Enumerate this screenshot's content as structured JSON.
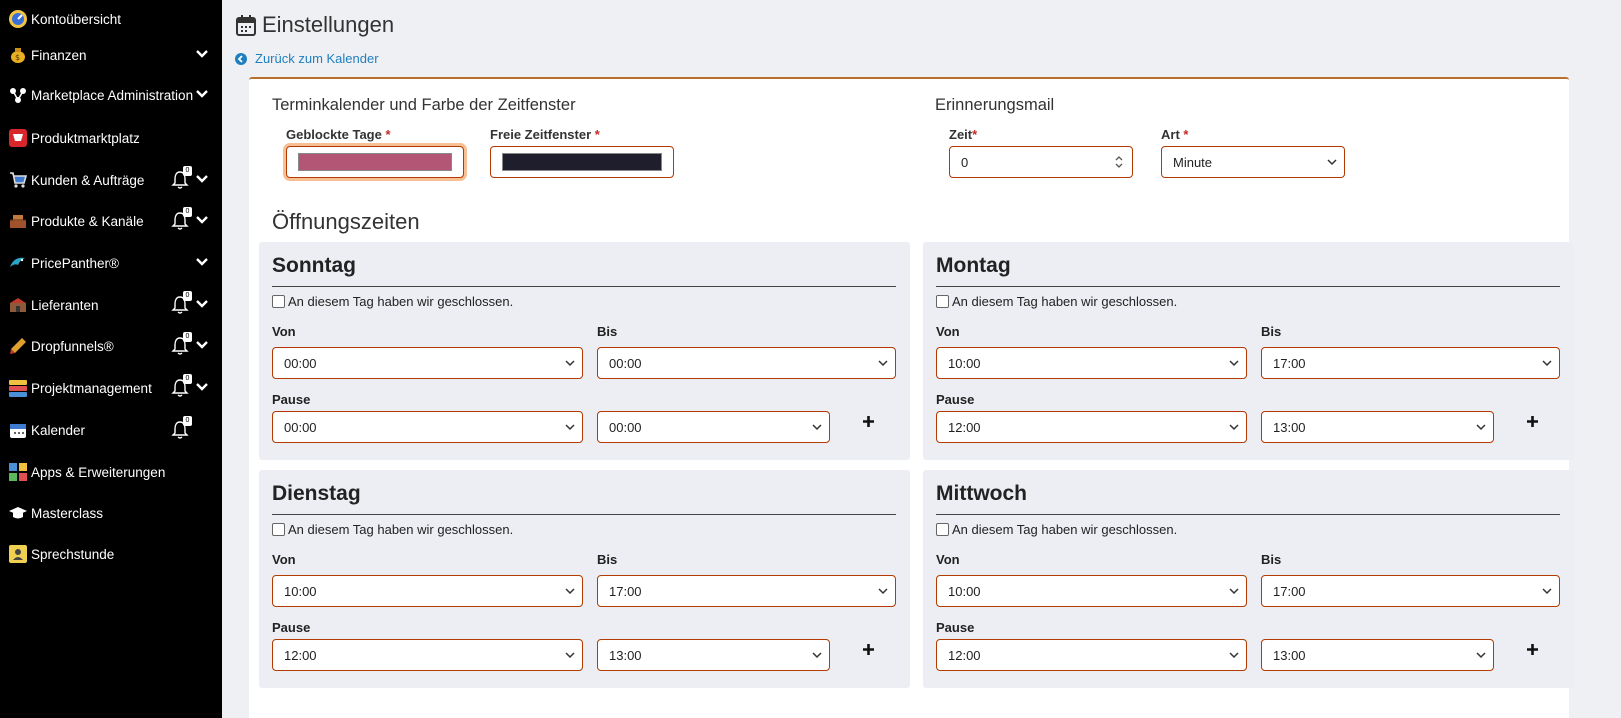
{
  "sidebar": {
    "items": [
      {
        "label": "Kontoübersicht",
        "icon": "dashboard-icon",
        "bell": false,
        "chevron": false
      },
      {
        "label": "Finanzen",
        "icon": "money-bag-icon",
        "bell": false,
        "chevron": true
      },
      {
        "label": "Marketplace Administration",
        "icon": "network-icon",
        "bell": false,
        "chevron": true
      },
      {
        "label": "Produktmarktplatz",
        "icon": "marketplace-icon",
        "bell": false,
        "chevron": false
      },
      {
        "label": "Kunden & Aufträge",
        "icon": "cart-icon",
        "bell": true,
        "badge": "0",
        "chevron": true
      },
      {
        "label": "Produkte & Kanäle",
        "icon": "products-icon",
        "bell": true,
        "badge": "0",
        "chevron": true
      },
      {
        "label": "PricePanther®",
        "icon": "panther-icon",
        "bell": false,
        "chevron": true
      },
      {
        "label": "Lieferanten",
        "icon": "supplier-icon",
        "bell": true,
        "badge": "0",
        "chevron": true
      },
      {
        "label": "Dropfunnels®",
        "icon": "funnel-icon",
        "bell": true,
        "badge": "0",
        "chevron": true
      },
      {
        "label": "Projektmanagement",
        "icon": "project-icon",
        "bell": true,
        "badge": "0",
        "chevron": true
      },
      {
        "label": "Kalender",
        "icon": "calendar-icon",
        "bell": true,
        "badge": "0",
        "chevron": false
      },
      {
        "label": "Apps & Erweiterungen",
        "icon": "puzzle-icon",
        "bell": false,
        "chevron": false
      },
      {
        "label": "Masterclass",
        "icon": "graduation-cap-icon",
        "bell": false,
        "chevron": false
      },
      {
        "label": "Sprechstunde",
        "icon": "consultation-icon",
        "bell": false,
        "chevron": false
      }
    ]
  },
  "header": {
    "title": "Einstellungen",
    "back_link": "Zurück zum Kalender"
  },
  "calendar_settings": {
    "section_title": "Terminkalender und Farbe der Zeitfenster",
    "blocked_days_label": "Geblockte Tage",
    "blocked_days_color": "#b35574",
    "free_slots_label": "Freie Zeitfenster",
    "free_slots_color": "#1e1e2c",
    "required_mark": "*"
  },
  "reminder": {
    "section_title": "Erinnerungsmail",
    "time_label": "Zeit",
    "time_value": "0",
    "type_label": "Art",
    "type_value": "Minute"
  },
  "opening_hours": {
    "title": "Öffnungszeiten",
    "closed_text": "An diesem Tag haben wir geschlossen.",
    "from_label": "Von",
    "to_label": "Bis",
    "pause_label": "Pause",
    "days": [
      {
        "name": "Sonntag",
        "from": "00:00",
        "to": "00:00",
        "pause_from": "00:00",
        "pause_to": "00:00"
      },
      {
        "name": "Montag",
        "from": "10:00",
        "to": "17:00",
        "pause_from": "12:00",
        "pause_to": "13:00"
      },
      {
        "name": "Dienstag",
        "from": "10:00",
        "to": "17:00",
        "pause_from": "12:00",
        "pause_to": "13:00"
      },
      {
        "name": "Mittwoch",
        "from": "10:00",
        "to": "17:00",
        "pause_from": "12:00",
        "pause_to": "13:00"
      }
    ]
  },
  "colors": {
    "accent": "#b8702a",
    "border": "#b33a00",
    "link": "#1f7fbf"
  }
}
